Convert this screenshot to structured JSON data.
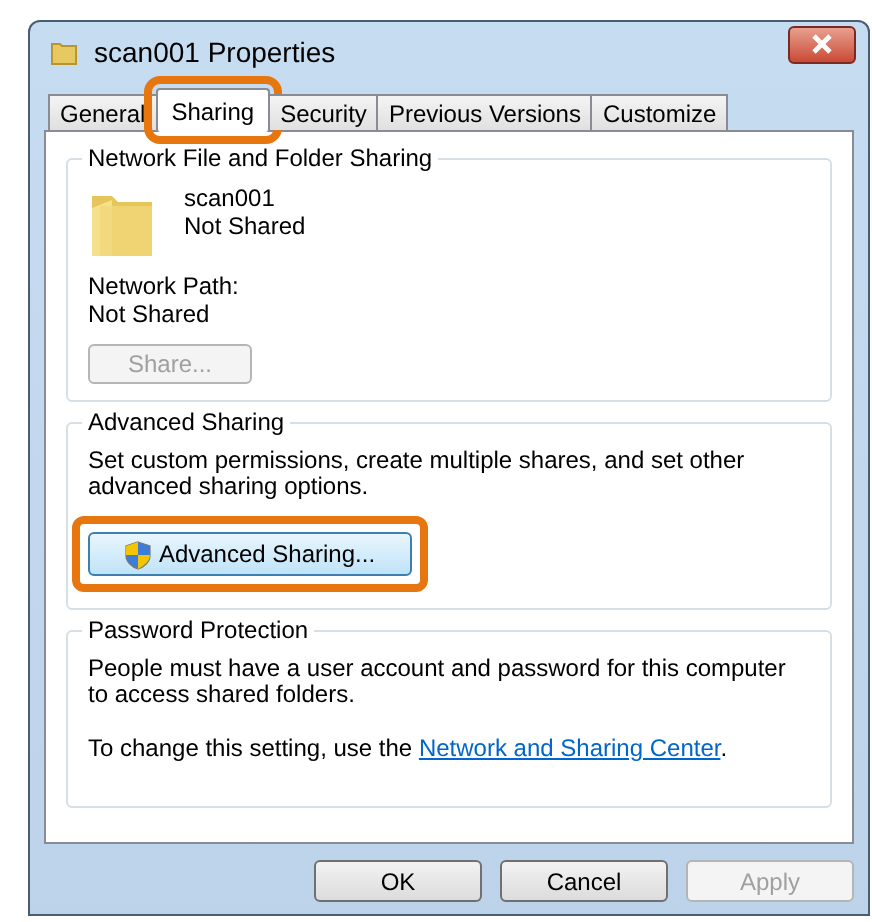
{
  "window": {
    "title": "scan001 Properties"
  },
  "tabs": [
    {
      "label": "General",
      "selected": false,
      "highlighted": false
    },
    {
      "label": "Sharing",
      "selected": true,
      "highlighted": true
    },
    {
      "label": "Security",
      "selected": false,
      "highlighted": false
    },
    {
      "label": "Previous Versions",
      "selected": false,
      "highlighted": false
    },
    {
      "label": "Customize",
      "selected": false,
      "highlighted": false
    }
  ],
  "network_sharing": {
    "title": "Network File and Folder Sharing",
    "folder_name": "scan001",
    "folder_status": "Not Shared",
    "path_label": "Network Path:",
    "path_value": "Not Shared",
    "button": {
      "label": "Share...",
      "disabled": true
    }
  },
  "advanced_sharing": {
    "title": "Advanced Sharing",
    "description": "Set custom permissions, create multiple shares, and set other advanced sharing options.",
    "button": {
      "label": "Advanced Sharing...",
      "highlighted": true
    }
  },
  "password_protection": {
    "title": "Password Protection",
    "description": "People must have a user account and password for this computer to access shared folders.",
    "change_text": "To change this setting, use the ",
    "link": "Network and Sharing Center",
    "link_suffix": "."
  },
  "buttons": [
    {
      "label": "OK",
      "disabled": false
    },
    {
      "label": "Cancel",
      "disabled": false
    },
    {
      "label": "Apply",
      "disabled": true
    }
  ]
}
